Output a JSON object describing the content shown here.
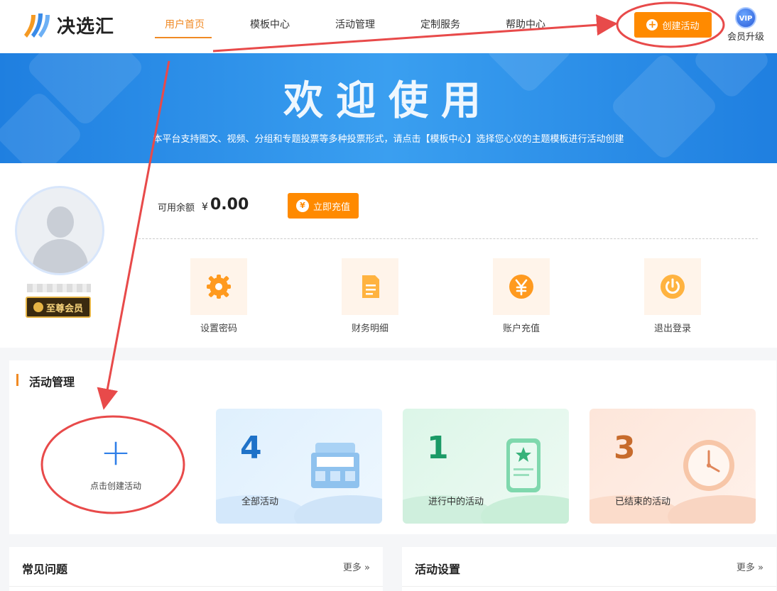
{
  "header": {
    "logo_text": "决选汇",
    "nav": [
      "用户首页",
      "模板中心",
      "活动管理",
      "定制服务",
      "帮助中心"
    ],
    "active_index": 0,
    "create_button": "创建活动",
    "vip_badge": "VIP",
    "vip_label": "会员升级"
  },
  "banner": {
    "title": "欢迎使用",
    "subtitle": "本平台支持图文、视频、分组和专题投票等多种投票形式，请点击【模板中心】选择您心仪的主题模板进行活动创建"
  },
  "profile": {
    "member_badge": "至尊会员",
    "balance_label": "可用余额",
    "currency_symbol": "¥",
    "balance_value": "0.00",
    "recharge_button": "立即充值",
    "recharge_icon": "¥",
    "quick_actions": [
      {
        "label": "设置密码",
        "icon": "gear-icon"
      },
      {
        "label": "财务明细",
        "icon": "document-icon"
      },
      {
        "label": "账户充值",
        "icon": "yen-icon"
      },
      {
        "label": "退出登录",
        "icon": "power-icon"
      }
    ]
  },
  "activity": {
    "title": "活动管理",
    "create_label": "点击创建活动",
    "stats": [
      {
        "value": "4",
        "label": "全部活动",
        "color": "#1f72c8"
      },
      {
        "value": "1",
        "label": "进行中的活动",
        "color": "#1a9a66"
      },
      {
        "value": "3",
        "label": "已结束的活动",
        "color": "#c76b2c"
      }
    ]
  },
  "panels": [
    {
      "title": "常见问题",
      "more": "更多 »"
    },
    {
      "title": "活动设置",
      "more": "更多 »"
    }
  ],
  "colors": {
    "accent": "#ff8a00",
    "annotation": "#e84a4a",
    "banner": "#2b8ee8"
  }
}
